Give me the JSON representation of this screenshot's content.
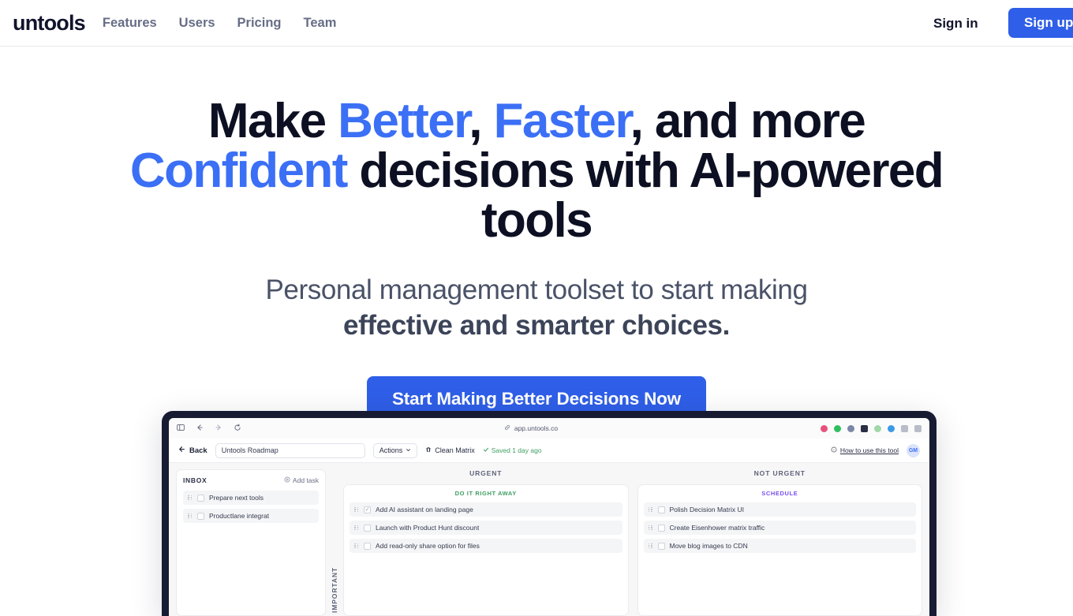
{
  "nav": {
    "brand": "untools",
    "links": [
      "Features",
      "Users",
      "Pricing",
      "Team"
    ],
    "signin_label": "Sign in",
    "signup_label": "Sign up",
    "accent_color": "#2f5fe8"
  },
  "hero": {
    "headline_parts": [
      {
        "text": "Make ",
        "accent": false
      },
      {
        "text": "Better",
        "accent": true
      },
      {
        "text": ", ",
        "accent": false
      },
      {
        "text": "Faster",
        "accent": true
      },
      {
        "text": ", and more ",
        "accent": false
      },
      {
        "text": "Confident",
        "accent": true
      },
      {
        "text": " decisions with AI-powered tools",
        "accent": false
      }
    ],
    "headline_plain": "Make Better, Faster, and more Confident decisions with AI-powered tools",
    "subtitle_line1": "Personal management toolset to start making",
    "subtitle_line2": "effective and smarter choices.",
    "cta_label": "Start Making Better Decisions Now",
    "accent_color": "#3b6ff5"
  },
  "mockup": {
    "browser": {
      "sidebar_icon": "sidebar-icon",
      "back_icon": "arrow-left-icon",
      "forward_icon": "arrow-right-icon",
      "reload_icon": "reload-icon",
      "link_icon": "link-icon",
      "url": "app.untools.co",
      "extension_colors": [
        "#e8517c",
        "#2fbf5f",
        "#7a87a8",
        "#2a2f45",
        "#9fd8a8",
        "#3b9ae8",
        "#8a90a3",
        "#8a90a3"
      ]
    },
    "toolbar": {
      "back_label": "Back",
      "doc_title": "Untools Roadmap",
      "actions_label": "Actions",
      "clean_label": "Clean Matrix",
      "saved_label": "Saved 1 day ago",
      "help_label": "How to use this tool",
      "avatar_initials": "GM"
    },
    "inbox": {
      "title": "INBOX",
      "add_label": "Add task",
      "tasks": [
        {
          "label": "Prepare next tools",
          "checked": false
        },
        {
          "label": "Productlane integrat",
          "checked": false
        }
      ]
    },
    "matrix": {
      "y_axis_label": "IMPORTANT",
      "columns": [
        {
          "header": "URGENT",
          "quadrant_title": "DO IT RIGHT AWAY",
          "quadrant_color": "#3f9e63",
          "tasks": [
            {
              "label": "Add AI assistant on landing page",
              "checked": true
            },
            {
              "label": "Launch with Product Hunt discount",
              "checked": false
            },
            {
              "label": "Add read-only share option for files",
              "checked": false
            }
          ]
        },
        {
          "header": "NOT URGENT",
          "quadrant_title": "SCHEDULE",
          "quadrant_color": "#7b4ff0",
          "tasks": [
            {
              "label": "Polish Decision Matrix UI",
              "checked": false
            },
            {
              "label": "Create Eisenhower matrix traffic",
              "checked": false
            },
            {
              "label": "Move blog images to CDN",
              "checked": false
            }
          ]
        }
      ]
    }
  }
}
